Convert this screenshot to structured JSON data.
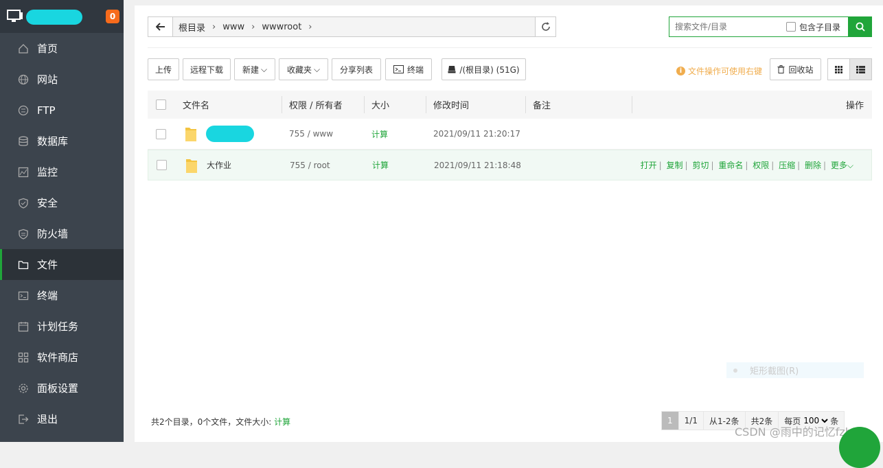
{
  "sidebar": {
    "badge": "0",
    "items": [
      {
        "label": "首页",
        "icon": "home-icon"
      },
      {
        "label": "网站",
        "icon": "globe-icon"
      },
      {
        "label": "FTP",
        "icon": "ftp-icon"
      },
      {
        "label": "数据库",
        "icon": "database-icon"
      },
      {
        "label": "监控",
        "icon": "monitor-icon"
      },
      {
        "label": "安全",
        "icon": "shield-icon"
      },
      {
        "label": "防火墙",
        "icon": "firewall-icon"
      },
      {
        "label": "文件",
        "icon": "folder-icon",
        "active": true
      },
      {
        "label": "终端",
        "icon": "terminal-icon"
      },
      {
        "label": "计划任务",
        "icon": "calendar-icon"
      },
      {
        "label": "软件商店",
        "icon": "apps-icon"
      },
      {
        "label": "面板设置",
        "icon": "gear-icon"
      },
      {
        "label": "退出",
        "icon": "logout-icon"
      }
    ]
  },
  "path": {
    "crumbs": [
      "根目录",
      "www",
      "wwwroot"
    ]
  },
  "search": {
    "placeholder": "搜索文件/目录",
    "include_sub": "包含子目录"
  },
  "toolbar": {
    "upload": "上传",
    "remote_download": "远程下载",
    "new": "新建",
    "favorites": "收藏夹",
    "share_list": "分享列表",
    "terminal": "终端",
    "disk": "/(根目录) (51G)",
    "tip": "文件操作可使用右键",
    "recycle": "回收站"
  },
  "table": {
    "headers": {
      "name": "文件名",
      "perm": "权限 / 所有者",
      "size": "大小",
      "mtime": "修改时间",
      "note": "备注",
      "ops": "操作"
    },
    "rows": [
      {
        "name": "",
        "perm": "755 / www",
        "size": "计算",
        "mtime": "2021/09/11 21:20:17"
      },
      {
        "name": "大作业",
        "perm": "755 / root",
        "size": "计算",
        "mtime": "2021/09/11 21:18:48"
      }
    ],
    "ops": [
      "打开",
      "复制",
      "剪切",
      "重命名",
      "权限",
      "压缩",
      "删除",
      "更多"
    ]
  },
  "footer": {
    "summary": "共2个目录，0个文件，文件大小:",
    "calc": "计算",
    "page_current": "1",
    "page_total": "1/1",
    "range": "从1-2条",
    "total": "共2条",
    "per_page_label": "每页",
    "per_page": "100",
    "unit": "条"
  },
  "context_ghost": "矩形截图(R)",
  "watermark": "CSDN @雨中的记忆fzh",
  "colors": {
    "accent": "#20a53a",
    "sidebar": "#3c444d",
    "badge": "#f76b1c",
    "tip": "#f0ad4e"
  }
}
